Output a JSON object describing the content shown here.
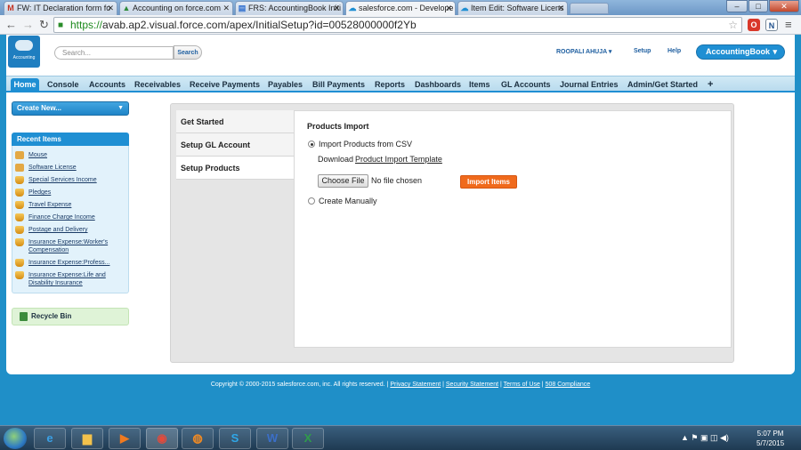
{
  "browser": {
    "tabs": [
      {
        "label": "FW: IT Declaration form fo",
        "icon": "M"
      },
      {
        "label": "Accounting on force.com",
        "icon": "▲"
      },
      {
        "label": "FRS: AccountingBook Initi",
        "icon": "▤"
      },
      {
        "label": "salesforce.com - Develope",
        "icon": "☁"
      },
      {
        "label": "Item Edit: Software Licens",
        "icon": "☁"
      }
    ],
    "url_scheme": "https://",
    "url_rest": "avab.ap2.visual.force.com/apex/InitialSetup?id=00528000000f2Yb",
    "window_buttons": {
      "minimize": "–",
      "maximize": "□",
      "close": "✕"
    }
  },
  "header": {
    "logo_text": "Accounting",
    "search_placeholder": "Search...",
    "search_button": "Search",
    "user_name": "ROOPALI AHUJA",
    "setup": "Setup",
    "help": "Help",
    "app_name": "AccountingBook"
  },
  "nav_tabs": [
    "Home",
    "Console",
    "Accounts",
    "Receivables",
    "Receive Payments",
    "Payables",
    "Bill Payments",
    "Reports",
    "Dashboards",
    "Items",
    "GL Accounts",
    "Journal Entries",
    "Admin/Get Started",
    "+"
  ],
  "sidebar": {
    "create_new": "Create New...",
    "recent_title": "Recent Items",
    "recent_items": [
      {
        "label": "Mouse",
        "icon": "item-icon"
      },
      {
        "label": "Software License",
        "icon": "item-icon"
      },
      {
        "label": "Special Services Income",
        "icon": "account-icon"
      },
      {
        "label": "Pledges",
        "icon": "account-icon"
      },
      {
        "label": "Travel Expense",
        "icon": "account-icon"
      },
      {
        "label": "Finance Charge Income",
        "icon": "account-icon"
      },
      {
        "label": "Postage and Delivery",
        "icon": "account-icon"
      },
      {
        "label": "Insurance Expense:Worker's Compensation",
        "icon": "account-icon"
      },
      {
        "label": "Insurance Expense:Profess...",
        "icon": "account-icon"
      },
      {
        "label": "Insurance Expense:Life and Disability Insurance",
        "icon": "account-icon"
      }
    ],
    "recycle_bin": "Recycle Bin"
  },
  "setup": {
    "steps": [
      "Get Started",
      "Setup GL Account",
      "Setup Products"
    ],
    "active_step": "Setup Products",
    "panel_title": "Products Import",
    "option_csv": "Import Products from CSV",
    "download_label": "Download",
    "template_link": "Product Import Template",
    "choose_file": "Choose File",
    "no_file": "No file chosen",
    "import_button": "Import Items",
    "option_manual": "Create Manually"
  },
  "footer": {
    "copyright": "Copyright © 2000-2015 salesforce.com, inc. All rights reserved. |",
    "privacy": "Privacy Statement",
    "security": "Security Statement",
    "terms": "Terms of Use",
    "compliance": "508 Compliance"
  },
  "taskbar": {
    "time": "5:07 PM",
    "date": "5/7/2015"
  },
  "colors": {
    "brand_blue": "#1f8fd3",
    "import_orange": "#f06a1c"
  }
}
